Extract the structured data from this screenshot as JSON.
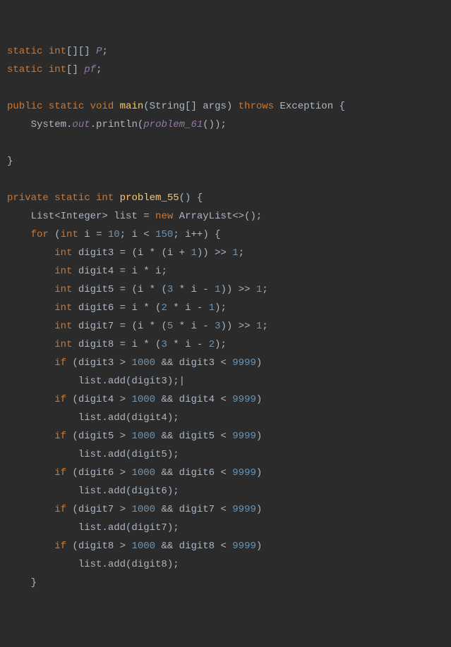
{
  "code": {
    "l1": {
      "a": "static",
      "b": "int",
      "c": "[][] ",
      "d": "P",
      "e": ";"
    },
    "l2": {
      "a": "static",
      "b": "int",
      "c": "[] ",
      "d": "pf",
      "e": ";"
    },
    "l3": {
      "a": "public static void",
      "b": "main",
      "c": "(String[] args) ",
      "d": "throws",
      "e": " Exception {"
    },
    "l4": {
      "a": "    System.",
      "b": "out",
      "c": ".println(",
      "d": "problem_61",
      "e": "());"
    },
    "l5": {
      "a": "}"
    },
    "l6": {
      "a": "private static int",
      "b": "problem_55",
      "c": "() {"
    },
    "l7": {
      "a": "    List<Integer> list = ",
      "b": "new",
      "c": " ArrayList<>();"
    },
    "l8": {
      "a": "    ",
      "b": "for",
      "c": " (",
      "d": "int",
      "e": " i = ",
      "f": "10",
      "g": "; i < ",
      "h": "150",
      "i": "; i++) {"
    },
    "l9": {
      "a": "        ",
      "b": "int",
      "c": " digit3 = (i * (i + ",
      "d": "1",
      "e": ")) >> ",
      "f": "1",
      "g": ";"
    },
    "l10": {
      "a": "        ",
      "b": "int",
      "c": " digit4 = i * i;"
    },
    "l11": {
      "a": "        ",
      "b": "int",
      "c": " digit5 = (i * (",
      "d": "3",
      "e": " * i - ",
      "f": "1",
      "g": ")) >> ",
      "h": "1",
      "i": ";"
    },
    "l12": {
      "a": "        ",
      "b": "int",
      "c": " digit6 = i * (",
      "d": "2",
      "e": " * i - ",
      "f": "1",
      "g": ");"
    },
    "l13": {
      "a": "        ",
      "b": "int",
      "c": " digit7 = (i * (",
      "d": "5",
      "e": " * i - ",
      "f": "3",
      "g": ")) >> ",
      "h": "1",
      "i": ";"
    },
    "l14": {
      "a": "        ",
      "b": "int",
      "c": " digit8 = i * (",
      "d": "3",
      "e": " * i - ",
      "f": "2",
      "g": ");"
    },
    "l15": {
      "a": "        ",
      "b": "if",
      "c": " (digit3 > ",
      "d": "1000",
      "e": " && digit3 < ",
      "f": "9999",
      "g": ")"
    },
    "l16": {
      "a": "            list.add(digit3);",
      "b": "|"
    },
    "l17": {
      "a": "        ",
      "b": "if",
      "c": " (digit4 > ",
      "d": "1000",
      "e": " && digit4 < ",
      "f": "9999",
      "g": ")"
    },
    "l18": {
      "a": "            list.add(digit4);"
    },
    "l19": {
      "a": "        ",
      "b": "if",
      "c": " (digit5 > ",
      "d": "1000",
      "e": " && digit5 < ",
      "f": "9999",
      "g": ")"
    },
    "l20": {
      "a": "            list.add(digit5);"
    },
    "l21": {
      "a": "        ",
      "b": "if",
      "c": " (digit6 > ",
      "d": "1000",
      "e": " && digit6 < ",
      "f": "9999",
      "g": ")"
    },
    "l22": {
      "a": "            list.add(digit6);"
    },
    "l23": {
      "a": "        ",
      "b": "if",
      "c": " (digit7 > ",
      "d": "1000",
      "e": " && digit7 < ",
      "f": "9999",
      "g": ")"
    },
    "l24": {
      "a": "            list.add(digit7);"
    },
    "l25": {
      "a": "        ",
      "b": "if",
      "c": " (digit8 > ",
      "d": "1000",
      "e": " && digit8 < ",
      "f": "9999",
      "g": ")"
    },
    "l26": {
      "a": "            list.add(digit8);"
    },
    "l27": {
      "a": "    }"
    }
  }
}
